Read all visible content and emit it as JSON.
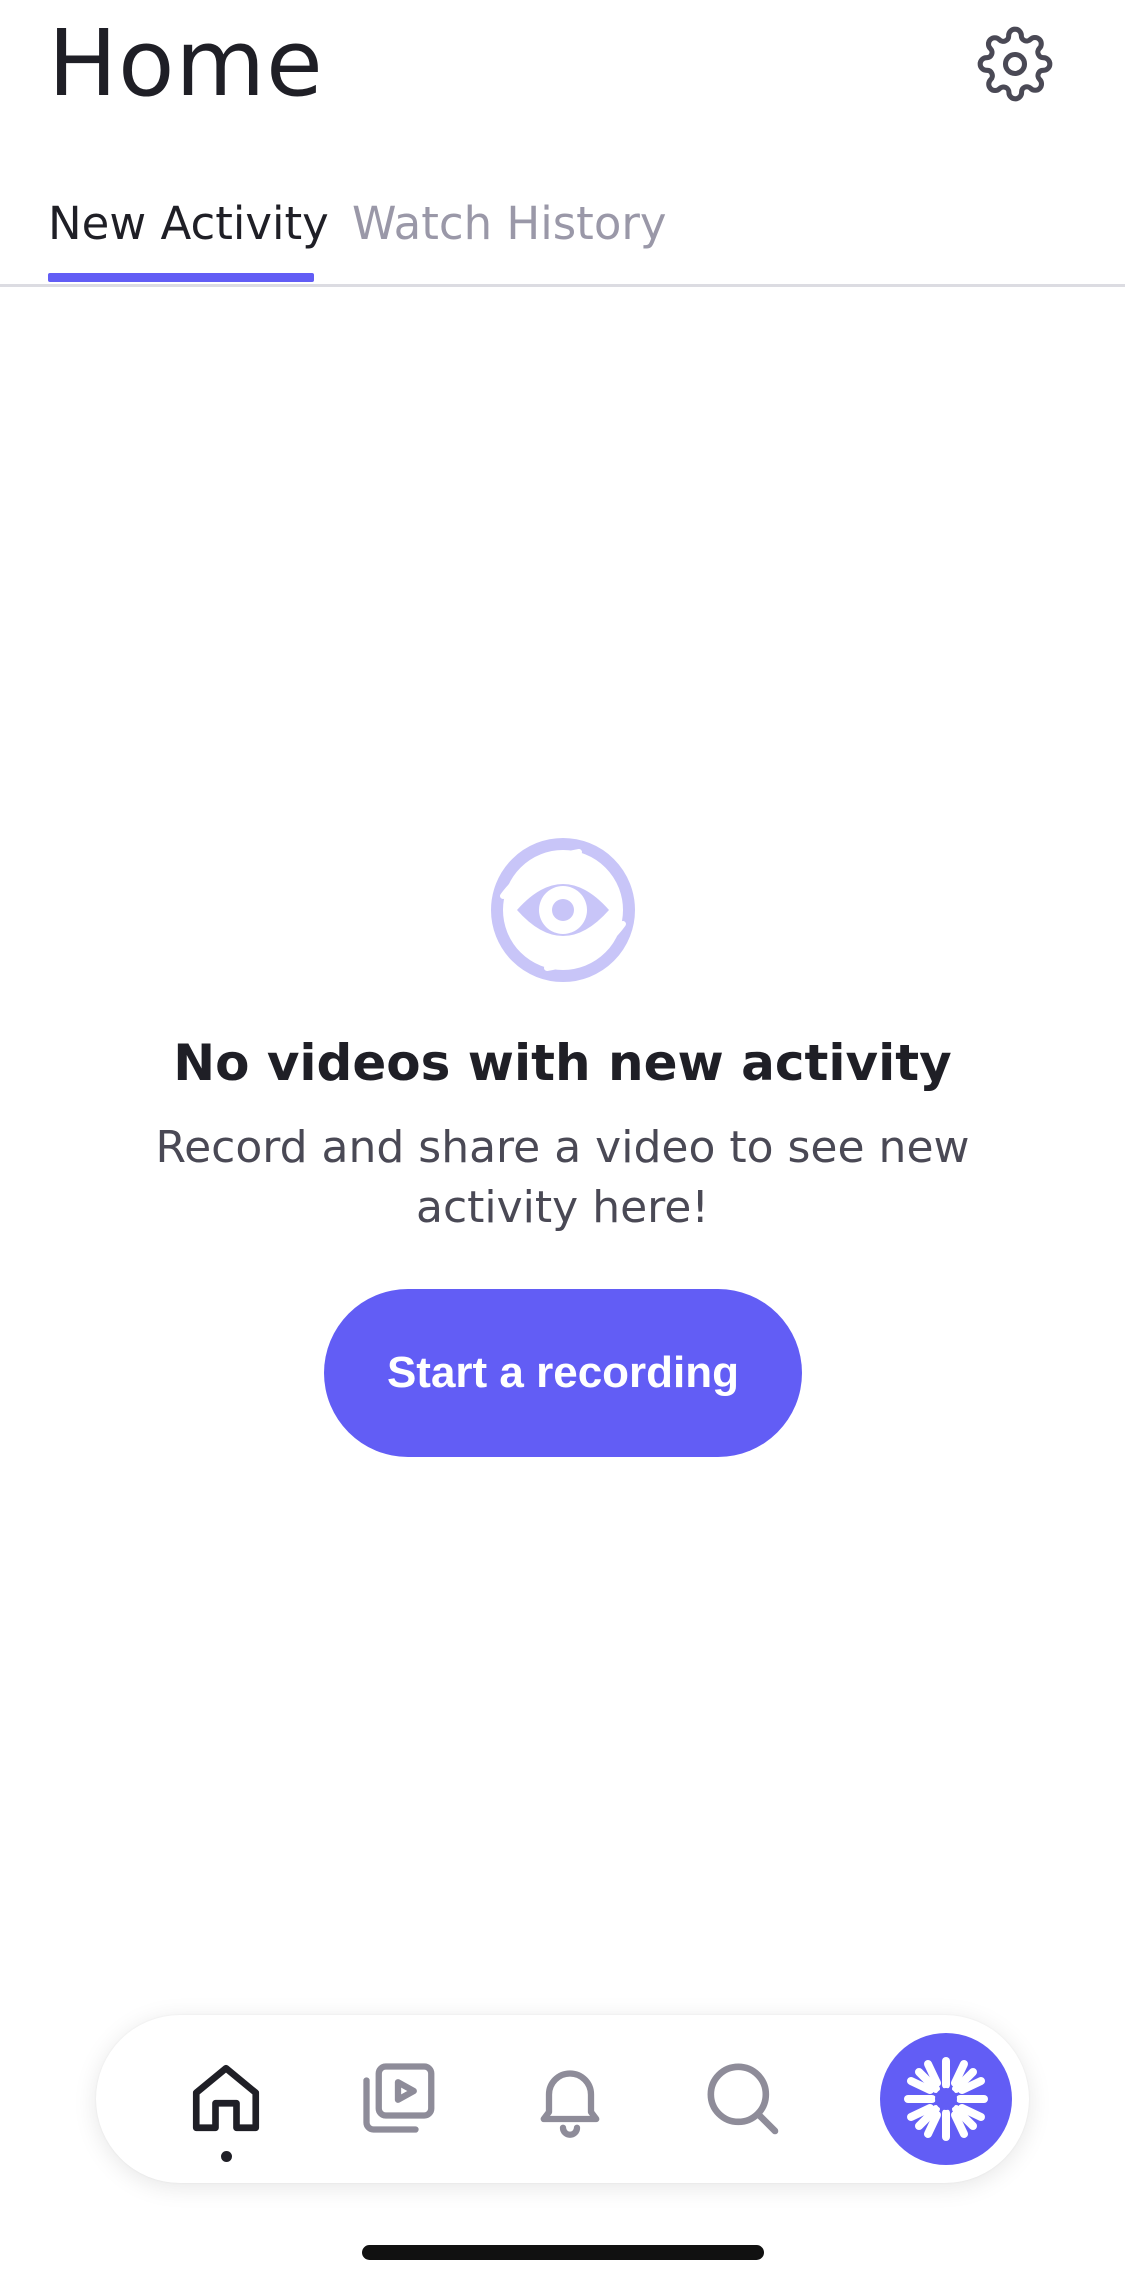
{
  "header": {
    "title": "Home",
    "settings_icon": "gear-icon"
  },
  "tabs": [
    {
      "label": "New Activity",
      "active": true
    },
    {
      "label": "Watch History",
      "active": false
    }
  ],
  "empty_state": {
    "icon": "eye-icon",
    "title": "No videos with new activity",
    "description": "Record and share a video to see new activity here!",
    "cta_label": "Start a recording"
  },
  "bottom_nav": {
    "items": [
      {
        "name": "home",
        "icon": "home-icon",
        "active": true
      },
      {
        "name": "library",
        "icon": "video-library-icon",
        "active": false
      },
      {
        "name": "notifications",
        "icon": "bell-icon",
        "active": false
      },
      {
        "name": "search",
        "icon": "search-icon",
        "active": false
      }
    ],
    "record_icon": "loom-record-icon"
  },
  "colors": {
    "accent": "#625df5",
    "accent_light": "#c8c5f8",
    "text_primary": "#1f1f26",
    "text_muted": "#9a98a8"
  }
}
